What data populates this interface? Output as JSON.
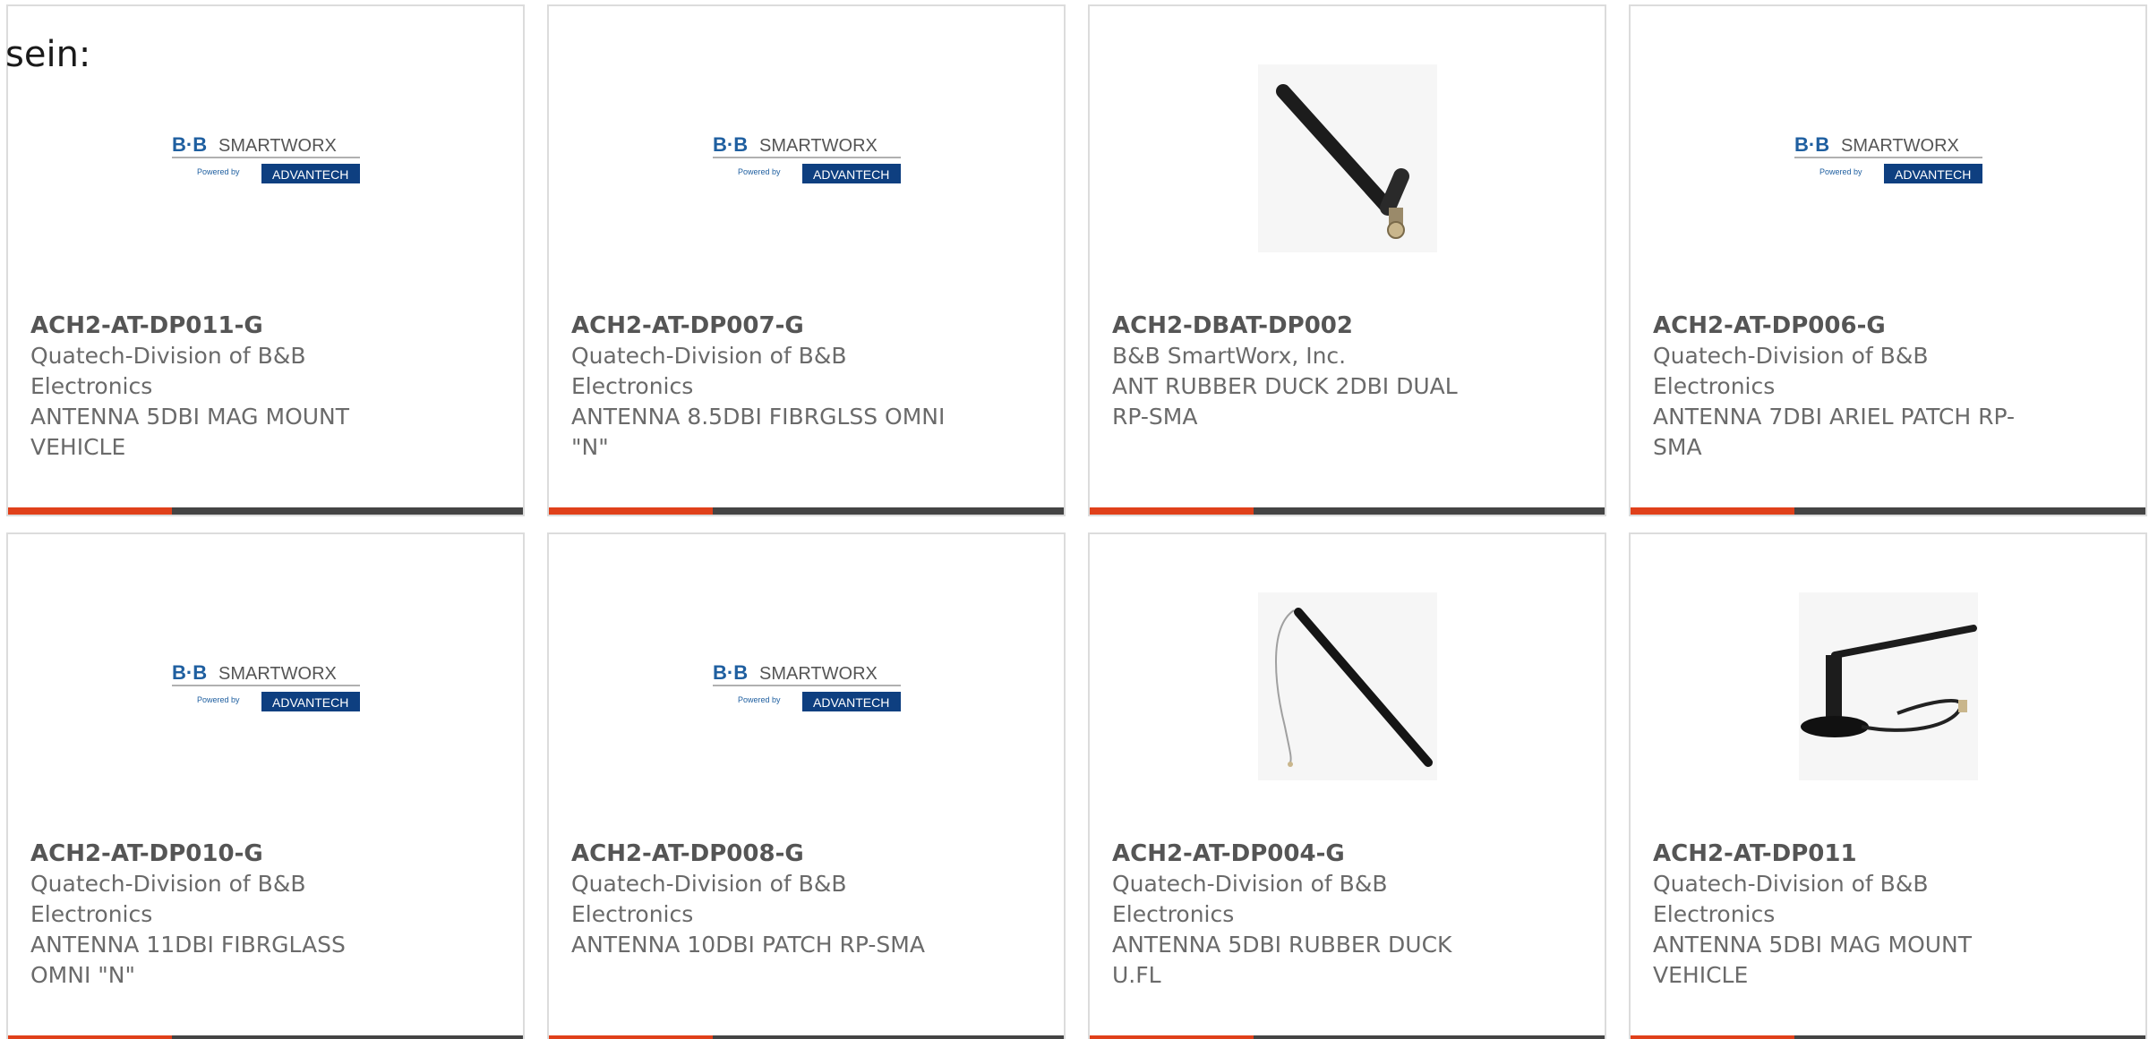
{
  "intro_text": "sein:",
  "colors": {
    "accent": "#e0401a",
    "bar": "#444444",
    "logo_blue": "#1f5fa0",
    "logo_navy": "#0e3f80"
  },
  "logo": {
    "brand": "B+B SmartWorx",
    "powered_by": "Powered by",
    "partner": "ADVANTECH"
  },
  "products": [
    {
      "part": "ACH2-AT-DP011-G",
      "vendor": "Quatech-Division of B&B Electronics",
      "description": "ANTENNA 5DBI MAG MOUNT VEHICLE",
      "image": "logo-icon"
    },
    {
      "part": "ACH2-AT-DP007-G",
      "vendor": "Quatech-Division of B&B Electronics",
      "description": "ANTENNA 8.5DBI FIBRGLSS OMNI \"N\"",
      "image": "logo-icon"
    },
    {
      "part": "ACH2-DBAT-DP002",
      "vendor": "B&B SmartWorx, Inc.",
      "description": "ANT RUBBER DUCK 2DBI DUAL RP-SMA",
      "image": "rubber-duck-antenna-icon"
    },
    {
      "part": "ACH2-AT-DP006-G",
      "vendor": "Quatech-Division of B&B Electronics",
      "description": "ANTENNA 7DBI ARIEL PATCH RP-SMA",
      "image": "logo-icon"
    },
    {
      "part": "ACH2-AT-DP010-G",
      "vendor": "Quatech-Division of B&B Electronics",
      "description": "ANTENNA 11DBI FIBRGLASS OMNI \"N\"",
      "image": "logo-icon"
    },
    {
      "part": "ACH2-AT-DP008-G",
      "vendor": "Quatech-Division of B&B Electronics",
      "description": "ANTENNA 10DBI PATCH RP-SMA",
      "image": "logo-icon"
    },
    {
      "part": "ACH2-AT-DP004-G",
      "vendor": "Quatech-Division of B&B Electronics",
      "description": "ANTENNA 5DBI RUBBER DUCK U.FL",
      "image": "cabled-antenna-icon"
    },
    {
      "part": "ACH2-AT-DP011",
      "vendor": "Quatech-Division of B&B Electronics",
      "description": "ANTENNA 5DBI MAG MOUNT VEHICLE",
      "image": "mag-mount-antenna-icon"
    }
  ]
}
